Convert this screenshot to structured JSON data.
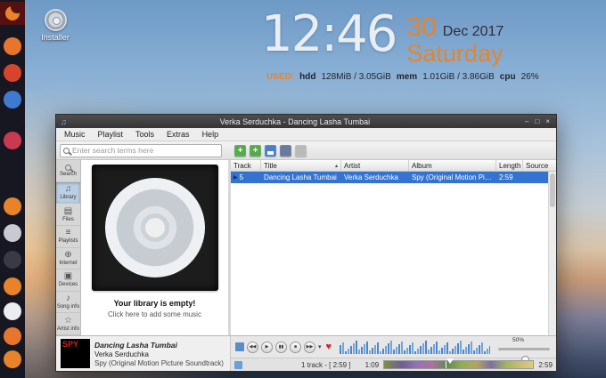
{
  "colors": {
    "accent_orange": "#e8832a",
    "selection_blue": "#3473cf",
    "titlebar_bg": "#3d3d3d",
    "dock_bg": "#171722",
    "heart_red": "#d8232a"
  },
  "desktop": {
    "installer": {
      "label": "Installer"
    },
    "clock": {
      "time": "12:46",
      "day": "30",
      "month_year": "Dec 2017",
      "weekday": "Saturday"
    },
    "stats": {
      "used_label": "USED:",
      "hdd_label": "hdd",
      "hdd_value": "128MiB / 3.05GiB",
      "mem_label": "mem",
      "mem_value": "1.01GiB / 3.86GiB",
      "cpu_label": "cpu",
      "cpu_value": "26%"
    }
  },
  "window": {
    "title": "Verka Serduchka - Dancing Lasha Tumbai",
    "menu": [
      "Music",
      "Playlist",
      "Tools",
      "Extras",
      "Help"
    ],
    "search": {
      "placeholder": "Enter search terms here"
    },
    "tabs": [
      {
        "label": "Search",
        "icon": ""
      },
      {
        "label": "Library",
        "icon": "♫"
      },
      {
        "label": "Files",
        "icon": "▤"
      },
      {
        "label": "Playlists",
        "icon": "≡"
      },
      {
        "label": "Internet",
        "icon": "⊕"
      },
      {
        "label": "Devices",
        "icon": "▣"
      },
      {
        "label": "Song info",
        "icon": "♪"
      },
      {
        "label": "Artist info",
        "icon": "☆"
      }
    ],
    "library_empty": {
      "title": "Your library is empty!",
      "subtitle": "Click here to add some music"
    },
    "playlist": {
      "columns": [
        "Track",
        "Title",
        "Artist",
        "Album",
        "Length",
        "Source"
      ],
      "rows": [
        {
          "track": "5",
          "title": "Dancing Lasha Tumbai",
          "artist": "Verka Serduchka",
          "album": "Spy (Original Motion Picture Soundtrack)",
          "length": "2:59"
        }
      ]
    },
    "now_playing": {
      "art_text": "SPY",
      "title": "Dancing Lasha Tumbai",
      "artist": "Verka Serduchka",
      "album": "Spy (Original Motion Picture Soundtrack)"
    },
    "controls": {
      "volume_label": "50%"
    },
    "status": {
      "summary": "1 track - [ 2:59 ]",
      "position": "1:09",
      "duration": "2:59"
    }
  },
  "icons": {
    "prev": "◀◀",
    "play": "▶",
    "pause": "▮▮",
    "stop": "■",
    "next": "▶▶",
    "dropdown": "▾",
    "heart": "♥",
    "sort_asc": "▴",
    "minimize": "–",
    "maximize": "□",
    "close": "×",
    "app": "♫",
    "add_song": "+",
    "add_folder": "+"
  }
}
